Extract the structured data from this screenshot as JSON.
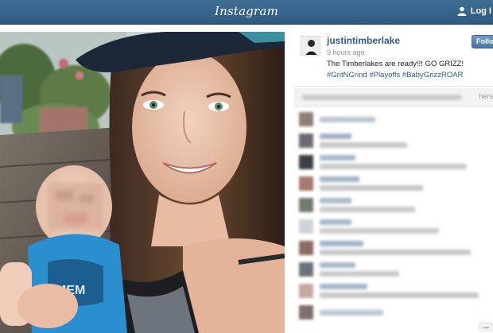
{
  "header": {
    "logo_text": "Instagram",
    "login_label": "Log I"
  },
  "post": {
    "username": "justintimberlake",
    "timestamp": "9 hours ago",
    "caption_text": "The Timberlakes are ready!!! GO GRIZZ!",
    "hashtags": [
      "#GritNGrind",
      "#Playoffs",
      "#BabyGrizzROAR"
    ],
    "follow_label": "Follow",
    "likes_text": "hers"
  },
  "icons": {
    "user": "user-icon",
    "more": "more-icon"
  },
  "colors": {
    "nav_bar": "#2f5a7f",
    "link_blue": "#2f5a87",
    "follow_button": "#4a77a6"
  }
}
